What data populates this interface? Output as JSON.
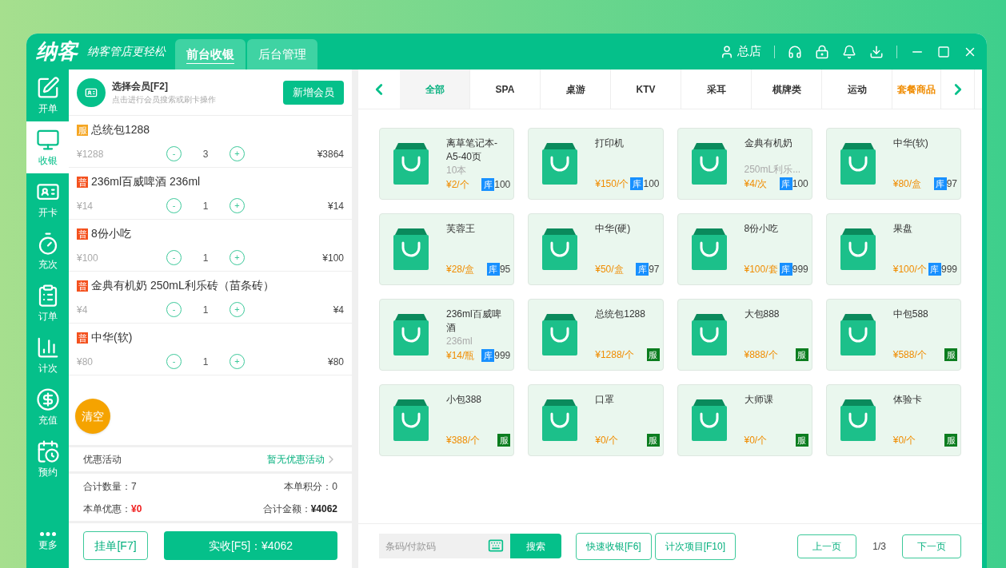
{
  "header": {
    "logo": "纳客",
    "slogan": "纳客管店更轻松",
    "tabs": [
      {
        "label": "前台收银",
        "selected": true
      },
      {
        "label": "后台管理",
        "selected": false
      }
    ],
    "store": "总店"
  },
  "sidebar": [
    {
      "label": "开单",
      "selected": false
    },
    {
      "label": "收银",
      "selected": true
    },
    {
      "label": "开卡",
      "selected": false
    },
    {
      "label": "充次",
      "selected": false
    },
    {
      "label": "订单",
      "selected": false
    },
    {
      "label": "计次",
      "selected": false
    },
    {
      "label": "充值",
      "selected": false
    },
    {
      "label": "预约",
      "selected": false
    },
    {
      "label": "更多",
      "selected": false
    }
  ],
  "member": {
    "title": "选择会员[F2]",
    "hint": "点击进行会员搜索或刷卡操作",
    "add_button": "新增会员"
  },
  "cart": [
    {
      "tag": "服",
      "color": "#f5a623",
      "name": "总统包1288",
      "price": "¥1288",
      "qty": "3",
      "total": "¥3864"
    },
    {
      "tag": "普",
      "color": "#f4511e",
      "name": "236ml百威啤酒 236ml",
      "price": "¥14",
      "qty": "1",
      "total": "¥14"
    },
    {
      "tag": "普",
      "color": "#f4511e",
      "name": "8份小吃",
      "price": "¥100",
      "qty": "1",
      "total": "¥100"
    },
    {
      "tag": "普",
      "color": "#f4511e",
      "name": "金典有机奶 250mL利乐砖（苗条砖）",
      "price": "¥4",
      "qty": "1",
      "total": "¥4"
    },
    {
      "tag": "普",
      "color": "#f4511e",
      "name": "中华(软)",
      "price": "¥80",
      "qty": "1",
      "total": "¥80"
    }
  ],
  "minus": "-",
  "plus": "+",
  "clear_button": "清空",
  "promo": {
    "label": "优惠活动",
    "value": "暂无优惠活动"
  },
  "summary": {
    "count_label": "合计数量：",
    "count": "7",
    "points_label": "本单积分：",
    "points": "0",
    "discount_label": "本单优惠：",
    "discount": "¥0",
    "amount_label": "合计金额：",
    "amount": "¥4062"
  },
  "hold_button": "挂单[F7]",
  "pay_button": "实收[F5]：¥4062",
  "categories": [
    {
      "label": "全部",
      "kind": "normal",
      "selected": true
    },
    {
      "label": "SPA",
      "kind": "normal",
      "selected": false
    },
    {
      "label": "桌游",
      "kind": "normal",
      "selected": false
    },
    {
      "label": "KTV",
      "kind": "normal",
      "selected": false
    },
    {
      "label": "采耳",
      "kind": "normal",
      "selected": false
    },
    {
      "label": "棋牌类",
      "kind": "normal",
      "selected": false
    },
    {
      "label": "运动",
      "kind": "normal",
      "selected": false
    },
    {
      "label": "套餐商品",
      "kind": "package",
      "selected": false
    }
  ],
  "products": [
    {
      "name": "离草笔记本-A5-40页",
      "sub": "10本",
      "price": "¥2/个",
      "kind": "stock",
      "badge": "库",
      "stock": "100"
    },
    {
      "name": "打印机",
      "price": "¥150/个",
      "kind": "stock",
      "badge": "库",
      "stock": "100"
    },
    {
      "name": "金典有机奶",
      "sub": "250mL利乐...",
      "price": "¥4/次",
      "kind": "stock",
      "badge": "库",
      "stock": "100"
    },
    {
      "name": "中华(软)",
      "price": "¥80/盒",
      "kind": "stock",
      "badge": "库",
      "stock": "97"
    },
    {
      "name": "芙蓉王",
      "price": "¥28/盒",
      "kind": "stock",
      "badge": "库",
      "stock": "95"
    },
    {
      "name": "中华(硬)",
      "price": "¥50/盒",
      "kind": "stock",
      "badge": "库",
      "stock": "97"
    },
    {
      "name": "8份小吃",
      "price": "¥100/套",
      "kind": "stock",
      "badge": "库",
      "stock": "999"
    },
    {
      "name": "果盘",
      "price": "¥100/个",
      "kind": "stock",
      "badge": "库",
      "stock": "999"
    },
    {
      "name": "236ml百威啤酒",
      "sub": "236ml",
      "price": "¥14/瓶",
      "kind": "stock",
      "badge": "库",
      "stock": "999"
    },
    {
      "name": "总统包1288",
      "price": "¥1288/个",
      "kind": "service",
      "badge": "服"
    },
    {
      "name": "大包888",
      "price": "¥888/个",
      "kind": "service",
      "badge": "服"
    },
    {
      "name": "中包588",
      "price": "¥588/个",
      "kind": "service",
      "badge": "服"
    },
    {
      "name": "小包388",
      "price": "¥388/个",
      "kind": "service",
      "badge": "服"
    },
    {
      "name": "口罩",
      "price": "¥0/个",
      "kind": "service",
      "badge": "服"
    },
    {
      "name": "大师课",
      "price": "¥0/个",
      "kind": "service",
      "badge": "服"
    },
    {
      "name": "体验卡",
      "price": "¥0/个",
      "kind": "service",
      "badge": "服"
    }
  ],
  "search": {
    "placeholder": "条码/付款码",
    "button": "搜索"
  },
  "quick_button": "快速收银[F6]",
  "count_button": "计次项目[F10]",
  "pager": {
    "prev": "上一页",
    "page": "1/3",
    "next": "下一页"
  }
}
